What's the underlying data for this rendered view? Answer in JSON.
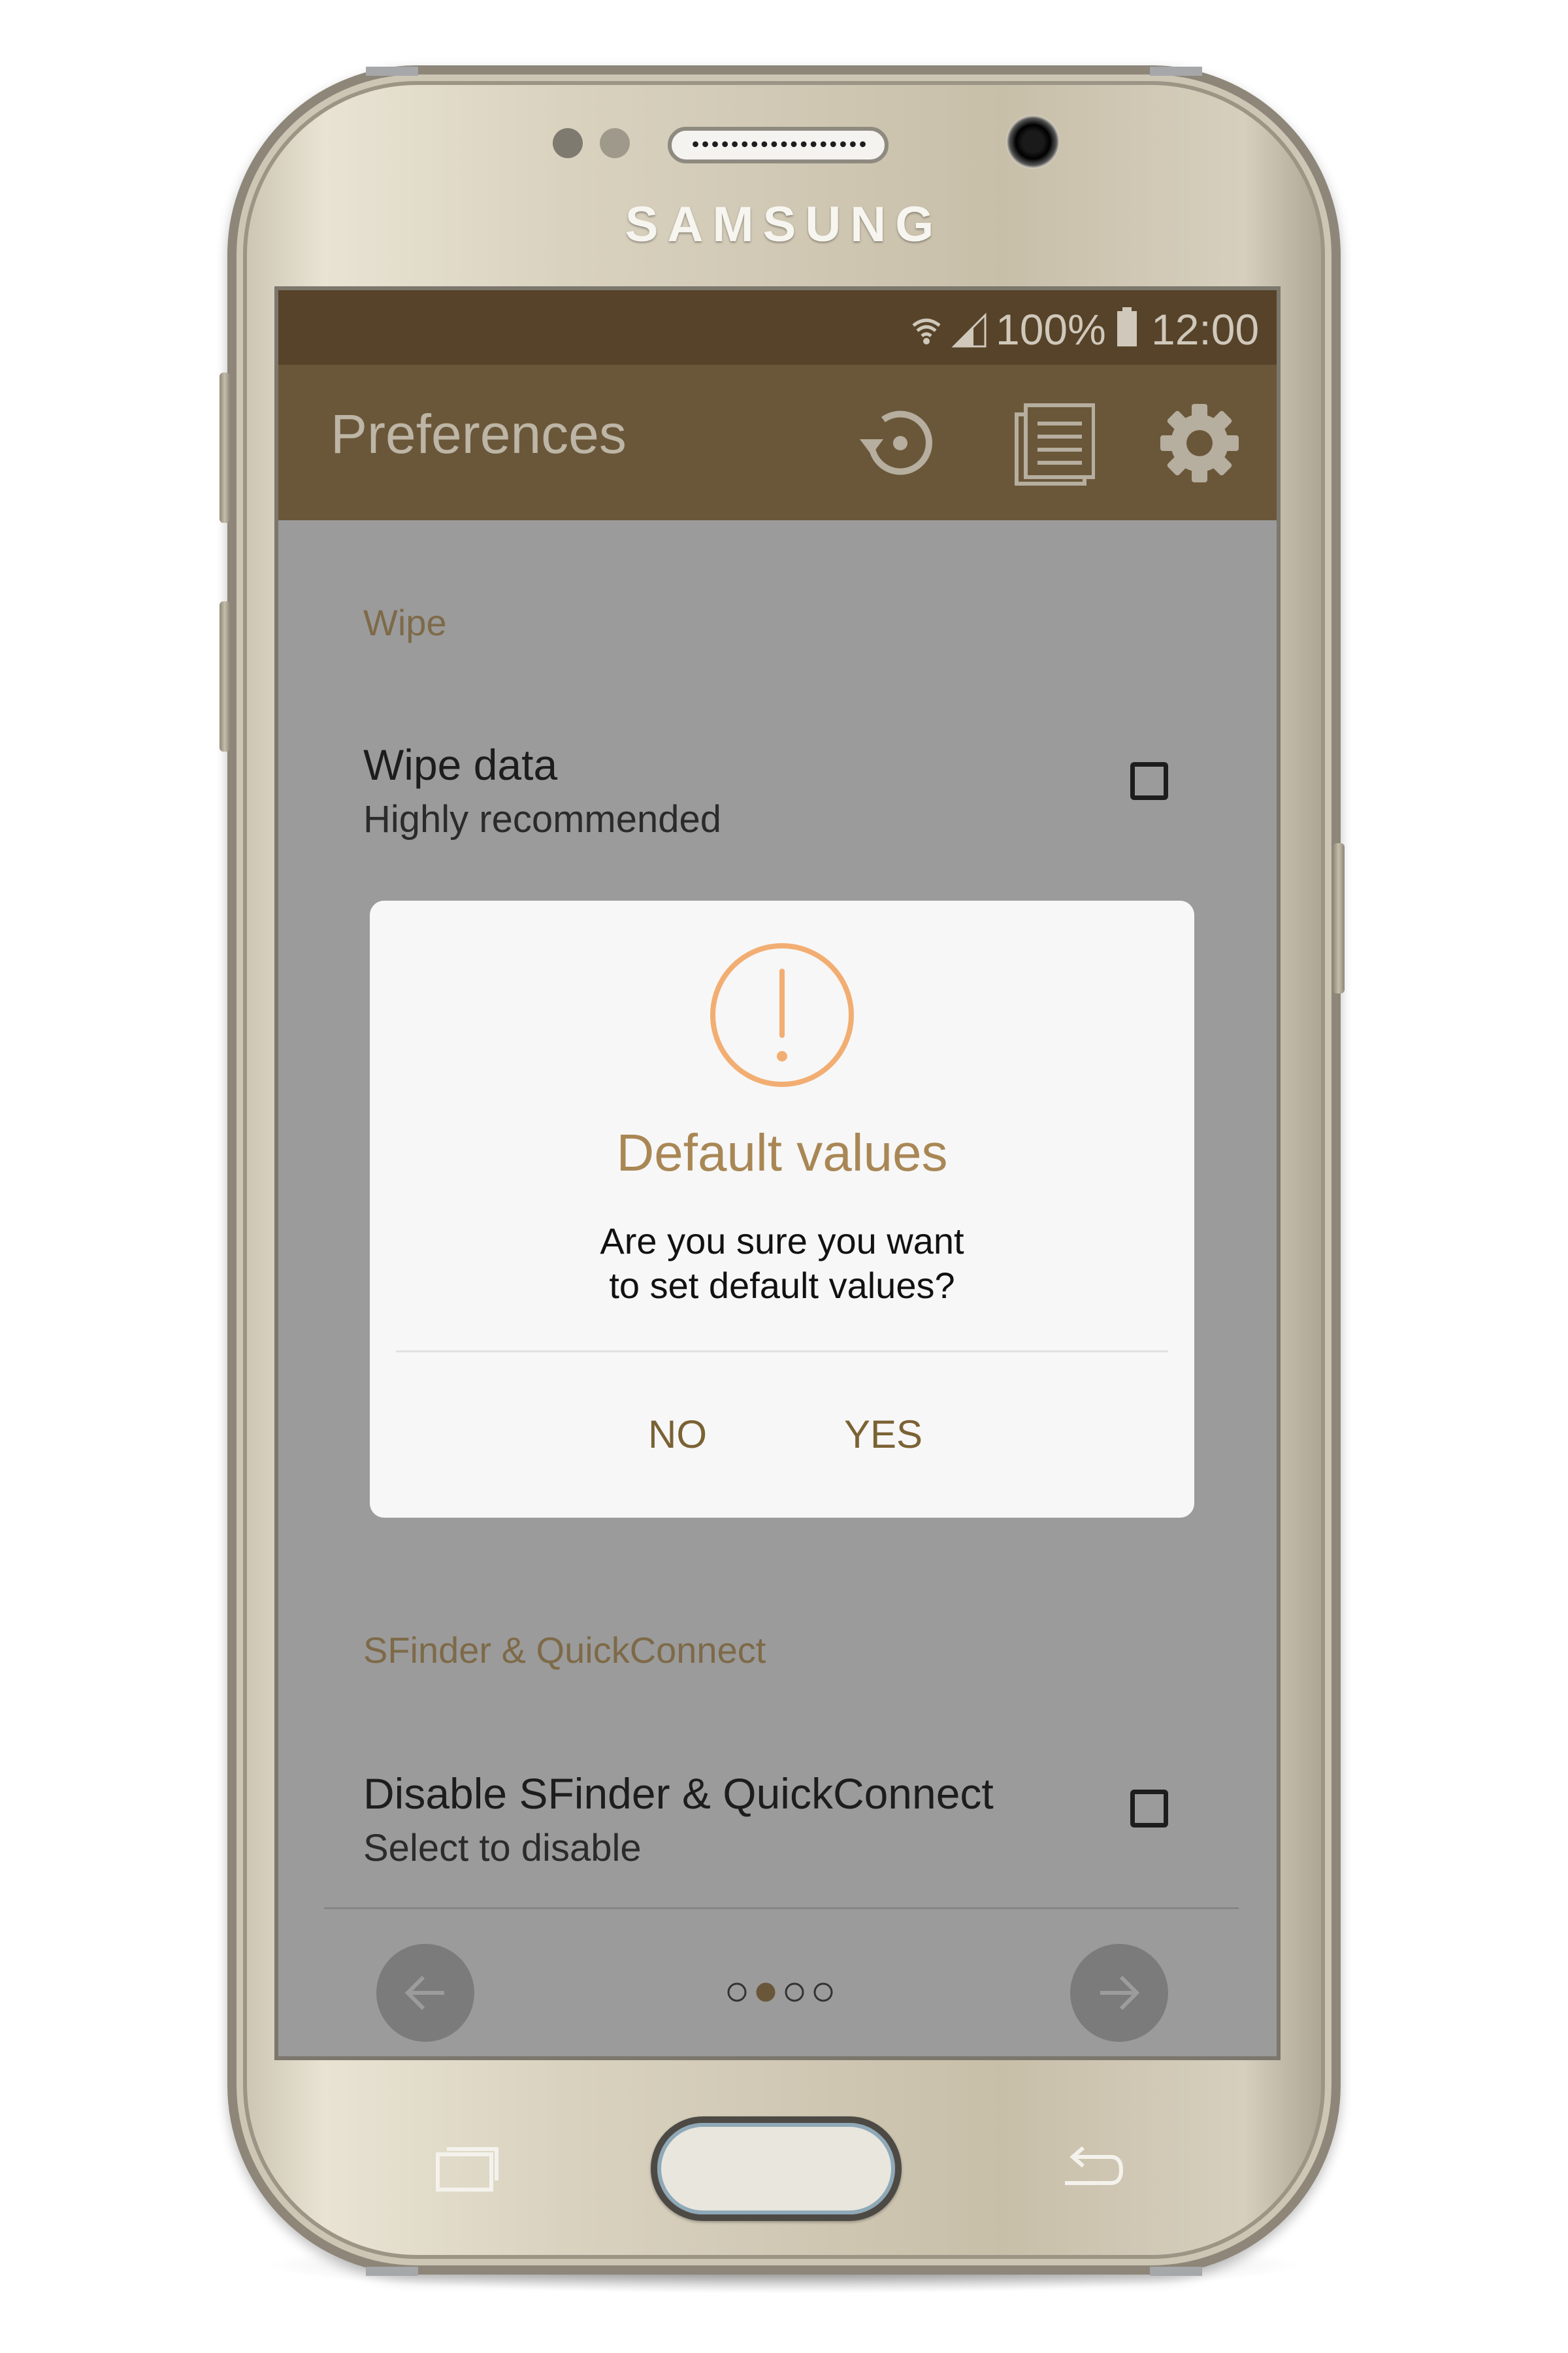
{
  "device": {
    "brand_logo": "SAMSUNG"
  },
  "status_bar": {
    "battery": "100%",
    "time": "12:00",
    "icons": [
      "wifi-icon",
      "signal-icon",
      "battery-icon"
    ]
  },
  "app_bar": {
    "title": "Preferences",
    "actions": [
      "restore-icon",
      "log-icon",
      "settings-gear-icon"
    ]
  },
  "preferences": {
    "wipe_section": {
      "header": "Wipe",
      "item_title": "Wipe data",
      "item_summary": "Highly recommended",
      "checked": false
    },
    "sfinder_section": {
      "header": "SFinder & QuickConnect",
      "item_title": "Disable SFinder & QuickConnect",
      "item_summary": "Select to disable",
      "checked": false
    }
  },
  "pager": {
    "page_count": 4,
    "current_page": 2
  },
  "dialog": {
    "icon": "warning-exclamation-icon",
    "title": "Default values",
    "message_line1": "Are you sure you want",
    "message_line2": "to set default values?",
    "negative_button": "NO",
    "positive_button": "YES"
  },
  "colors": {
    "status_bar": "#564329",
    "app_bar": "#6a573a",
    "dialog_accent": "#a98755",
    "warning_icon": "#f2ae72"
  }
}
